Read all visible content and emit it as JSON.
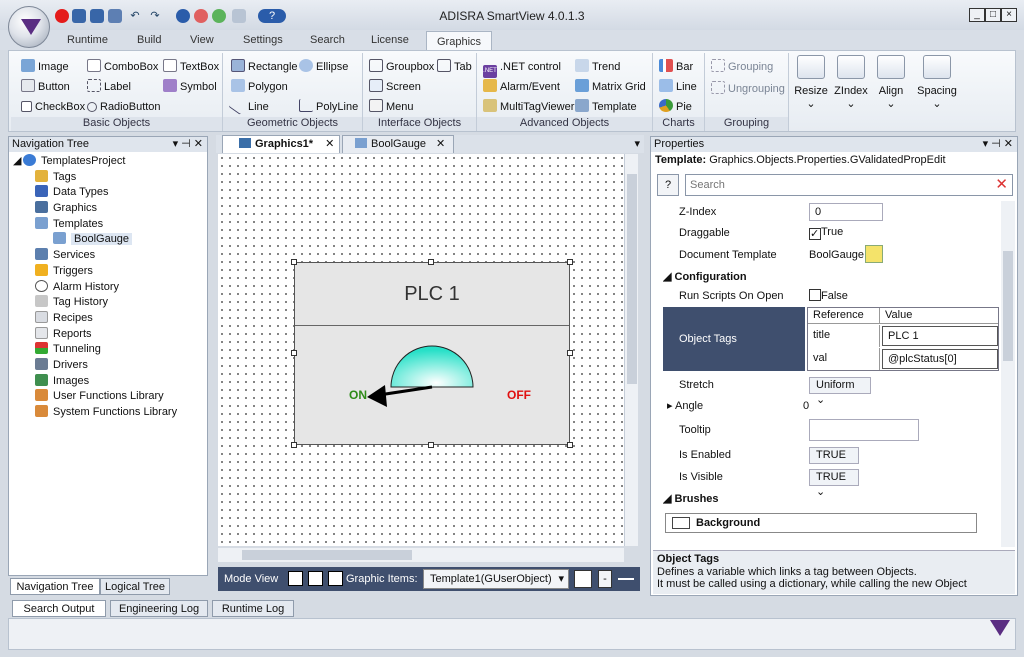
{
  "app": {
    "title": "ADISRA SmartView 4.0.1.3"
  },
  "menu": {
    "tabs": [
      "Runtime",
      "Build",
      "View",
      "Settings",
      "Search",
      "License",
      "Graphics"
    ],
    "active": "Graphics"
  },
  "ribbon": {
    "basic": {
      "label": "Basic Objects",
      "items": [
        "Image",
        "ComboBox",
        "TextBox",
        "Button",
        "Label",
        "Symbol",
        "CheckBox",
        "RadioButton"
      ]
    },
    "geometric": {
      "label": "Geometric Objects",
      "items": [
        "Rectangle",
        "Ellipse",
        "Polygon",
        "Line",
        "PolyLine"
      ]
    },
    "interface": {
      "label": "Interface Objects",
      "items": [
        "Groupbox",
        "Tab",
        "Screen",
        "Menu"
      ]
    },
    "advanced": {
      "label": "Advanced Objects",
      "items": [
        ".NET control",
        "Trend",
        "Alarm/Event",
        "Matrix Grid",
        "MultiTagViewer",
        "Template"
      ],
      "net_badge": ".NET"
    },
    "charts": {
      "label": "Charts",
      "items": [
        "Bar",
        "Line",
        "Pie"
      ]
    },
    "grouping": {
      "label": "Grouping",
      "items": [
        "Grouping",
        "Ungrouping"
      ]
    },
    "big": [
      "Resize",
      "ZIndex",
      "Align",
      "Spacing"
    ]
  },
  "nav": {
    "title": "Navigation Tree",
    "items": [
      "TemplatesProject",
      "Tags",
      "Data Types",
      "Graphics",
      "Templates",
      "BoolGauge",
      "Services",
      "Triggers",
      "Alarm History",
      "Tag History",
      "Recipes",
      "Reports",
      "Tunneling",
      "Drivers",
      "Images",
      "User Functions Library",
      "System Functions Library"
    ],
    "tabs": [
      "Navigation Tree",
      "Logical Tree"
    ]
  },
  "doc_tabs": [
    "Graphics1*",
    "BoolGauge"
  ],
  "gauge": {
    "title": "PLC 1",
    "on": "ON",
    "off": "OFF"
  },
  "bottombar": {
    "mode": "Mode View",
    "graphic_items": "Graphic Items:",
    "template_select": "Template1(GUserObject)"
  },
  "output_tabs": [
    "Search Output",
    "Engineering Log",
    "Runtime Log"
  ],
  "props": {
    "title": "Properties",
    "template_label": "Template:",
    "template_value": "Graphics.Objects.Properties.GValidatedPropEdit",
    "search_placeholder": "Search",
    "zindex": {
      "label": "Z-Index",
      "value": "0"
    },
    "draggable": {
      "label": "Draggable",
      "value": "True"
    },
    "doc_template": {
      "label": "Document Template",
      "value": "BoolGauge"
    },
    "config_header": "Configuration",
    "run_scripts": {
      "label": "Run Scripts On Open",
      "value": "False"
    },
    "object_tags": {
      "label": "Object Tags",
      "headers": [
        "Reference",
        "Value"
      ],
      "rows": [
        [
          "title",
          "PLC 1"
        ],
        [
          "val",
          "@plcStatus[0]"
        ]
      ]
    },
    "stretch": {
      "label": "Stretch",
      "value": "Uniform"
    },
    "angle": {
      "label": "Angle",
      "value": "0"
    },
    "tooltip": {
      "label": "Tooltip",
      "value": ""
    },
    "is_enabled": {
      "label": "Is Enabled",
      "value": "TRUE"
    },
    "is_visible": {
      "label": "Is Visible",
      "value": "TRUE"
    },
    "brushes_header": "Brushes",
    "background": {
      "label": "Background"
    },
    "desc_title": "Object Tags",
    "desc_line1": "Defines a variable which links a tag between Objects.",
    "desc_line2": "It must be called using a dictionary, while calling the new Object"
  },
  "colors": {
    "accent": "#3b4a6b",
    "gauge": "#40e8d4",
    "on": "#2e8b18",
    "off": "#e01010"
  }
}
